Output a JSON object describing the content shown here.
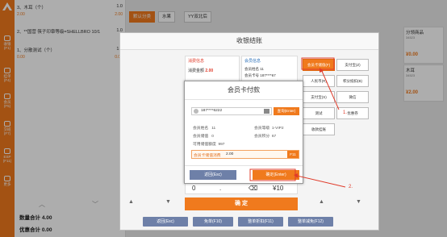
{
  "nav": {
    "items": [
      {
        "label": "收银",
        "key": "(F1)"
      },
      {
        "label": "挂单",
        "key": "(F4)"
      },
      {
        "label": "会员",
        "key": "(F5)"
      },
      {
        "label": "交班",
        "key": "(F7)"
      },
      {
        "label": "ESP",
        "key": "(F11)"
      },
      {
        "label": "更多",
        "key": ""
      }
    ]
  },
  "cart": {
    "rows": [
      {
        "name": "3、木耳（个）",
        "qty": "1.0",
        "sub": "2.00",
        "amount": "2.00"
      },
      {
        "name": "2、**国营 筷子印章等级=SHELLBRO 10/1",
        "qty": "1.0",
        "sub": "",
        "amount": ""
      },
      {
        "name": "1、分散测试（个）",
        "qty": "1.0",
        "sub": "0.00",
        "amount": "0.00"
      }
    ],
    "count_label": "数量合计",
    "count_value": "4.00",
    "discount_label": "优惠合计",
    "discount_value": "0.00"
  },
  "tabs": [
    "默认分类",
    "水果",
    "YY双北后"
  ],
  "cards": [
    {
      "name": "分领商品",
      "code": "34523",
      "price": "¥0.00"
    },
    {
      "name": "木耳",
      "code": "34523",
      "price": "¥2.00"
    }
  ],
  "checkout": {
    "title": "收银结账",
    "consume_title": "消费信息",
    "consume_label": "消费金额",
    "consume_value": "2.00",
    "member_title": "会员信息",
    "member_name_label": "会员姓名",
    "member_name": "11",
    "member_phone_label": "会员卡号",
    "member_phone": "187****67",
    "pay_buttons": [
      {
        "label": "会员卡储值(F)",
        "selected": true
      },
      {
        "label": "支付宝(Z)",
        "selected": false
      },
      {
        "label": "人民币(R)",
        "selected": false
      },
      {
        "label": "积分抵扣(B)",
        "selected": false
      },
      {
        "label": "支付宝(S)",
        "selected": false
      },
      {
        "label": "微信",
        "selected": false
      },
      {
        "label": "测试",
        "selected": false
      },
      {
        "label": "优惠券",
        "selected": false
      },
      {
        "label": "收款挂账",
        "selected": false
      }
    ],
    "keypad": [
      "0",
      ".",
      "⌫",
      "¥10"
    ],
    "confirm": "确 定",
    "bottom_buttons": [
      "返回(Esc)",
      "免单(F10)",
      "整单折扣(F11)",
      "整单减免(F12)"
    ],
    "annotation1": "1.",
    "annotation2": "2."
  },
  "member_card": {
    "title": "会员卡付款",
    "search_value": "187****6222",
    "search_button": "查询(Enter)",
    "name_label": "会员姓名",
    "name": "11",
    "level_label": "会员等级",
    "level": "1-VIP2",
    "balance_label": "会员储值",
    "balance": "0",
    "points_label": "会员积分",
    "points": "67",
    "usable_label": "可用储值额度",
    "usable": "997",
    "pay_label": "会员卡储值消费",
    "pay_value": "2.00",
    "pay_suffix": "F11",
    "back_button": "返回(Esc)",
    "confirm_button": "确定(Enter)"
  }
}
